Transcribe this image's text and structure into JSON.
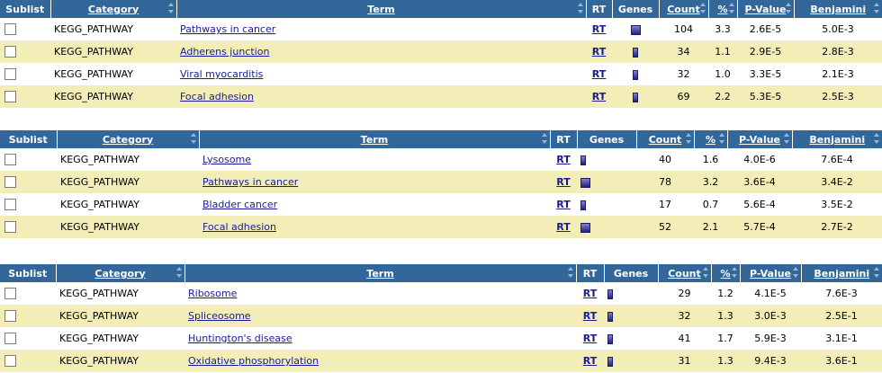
{
  "headers": {
    "sublist": "Sublist",
    "category": "Category",
    "term": "Term",
    "rt": "RT",
    "genes": "Genes",
    "count": "Count",
    "percent": "%",
    "pvalue": "P-Value",
    "benjamini": "Benjamini"
  },
  "tables": [
    {
      "rows": [
        {
          "category": "KEGG_PATHWAY",
          "term": "Pathways in cancer",
          "rt": "RT",
          "count": "104",
          "percent": "3.3",
          "pvalue": "2.6E-5",
          "benjamini": "5.0E-3",
          "bar": "wide"
        },
        {
          "category": "KEGG_PATHWAY",
          "term": "Adherens junction",
          "rt": "RT",
          "count": "34",
          "percent": "1.1",
          "pvalue": "2.9E-5",
          "benjamini": "2.8E-3",
          "bar": "thin"
        },
        {
          "category": "KEGG_PATHWAY",
          "term": "Viral myocarditis",
          "rt": "RT",
          "count": "32",
          "percent": "1.0",
          "pvalue": "3.3E-5",
          "benjamini": "2.1E-3",
          "bar": "thin"
        },
        {
          "category": "KEGG_PATHWAY",
          "term": "Focal adhesion",
          "rt": "RT",
          "count": "69",
          "percent": "2.2",
          "pvalue": "5.3E-5",
          "benjamini": "2.5E-3",
          "bar": "thin"
        }
      ]
    },
    {
      "rows": [
        {
          "category": "KEGG_PATHWAY",
          "term": "Lysosome",
          "rt": "RT",
          "count": "40",
          "percent": "1.6",
          "pvalue": "4.0E-6",
          "benjamini": "7.6E-4",
          "bar": "thin"
        },
        {
          "category": "KEGG_PATHWAY",
          "term": "Pathways in cancer",
          "rt": "RT",
          "count": "78",
          "percent": "3.2",
          "pvalue": "3.6E-4",
          "benjamini": "3.4E-2",
          "bar": "wide"
        },
        {
          "category": "KEGG_PATHWAY",
          "term": "Bladder cancer",
          "rt": "RT",
          "count": "17",
          "percent": "0.7",
          "pvalue": "5.6E-4",
          "benjamini": "3.5E-2",
          "bar": "thin"
        },
        {
          "category": "KEGG_PATHWAY",
          "term": "Focal adhesion",
          "rt": "RT",
          "count": "52",
          "percent": "2.1",
          "pvalue": "5.7E-4",
          "benjamini": "2.7E-2",
          "bar": "wide"
        }
      ]
    },
    {
      "rows": [
        {
          "category": "KEGG_PATHWAY",
          "term": "Ribosome",
          "rt": "RT",
          "count": "29",
          "percent": "1.2",
          "pvalue": "4.1E-5",
          "benjamini": "7.6E-3",
          "bar": "thin"
        },
        {
          "category": "KEGG_PATHWAY",
          "term": "Spliceosome",
          "rt": "RT",
          "count": "32",
          "percent": "1.3",
          "pvalue": "3.0E-3",
          "benjamini": "2.5E-1",
          "bar": "thin"
        },
        {
          "category": "KEGG_PATHWAY",
          "term": "Huntington's disease",
          "rt": "RT",
          "count": "41",
          "percent": "1.7",
          "pvalue": "5.9E-3",
          "benjamini": "3.1E-1",
          "bar": "thin"
        },
        {
          "category": "KEGG_PATHWAY",
          "term": "Oxidative phosphorylation",
          "rt": "RT",
          "count": "31",
          "percent": "1.3",
          "pvalue": "9.4E-3",
          "benjamini": "3.6E-1",
          "bar": "thin"
        }
      ]
    }
  ],
  "colors": {
    "header_bg": "#336699",
    "row_alt_bg": "#f3eeb8",
    "link": "#1a1a99"
  },
  "icons": {
    "sort": "sort-arrows-icon",
    "genes": "gene-bar-icon",
    "checkbox": "checkbox"
  }
}
